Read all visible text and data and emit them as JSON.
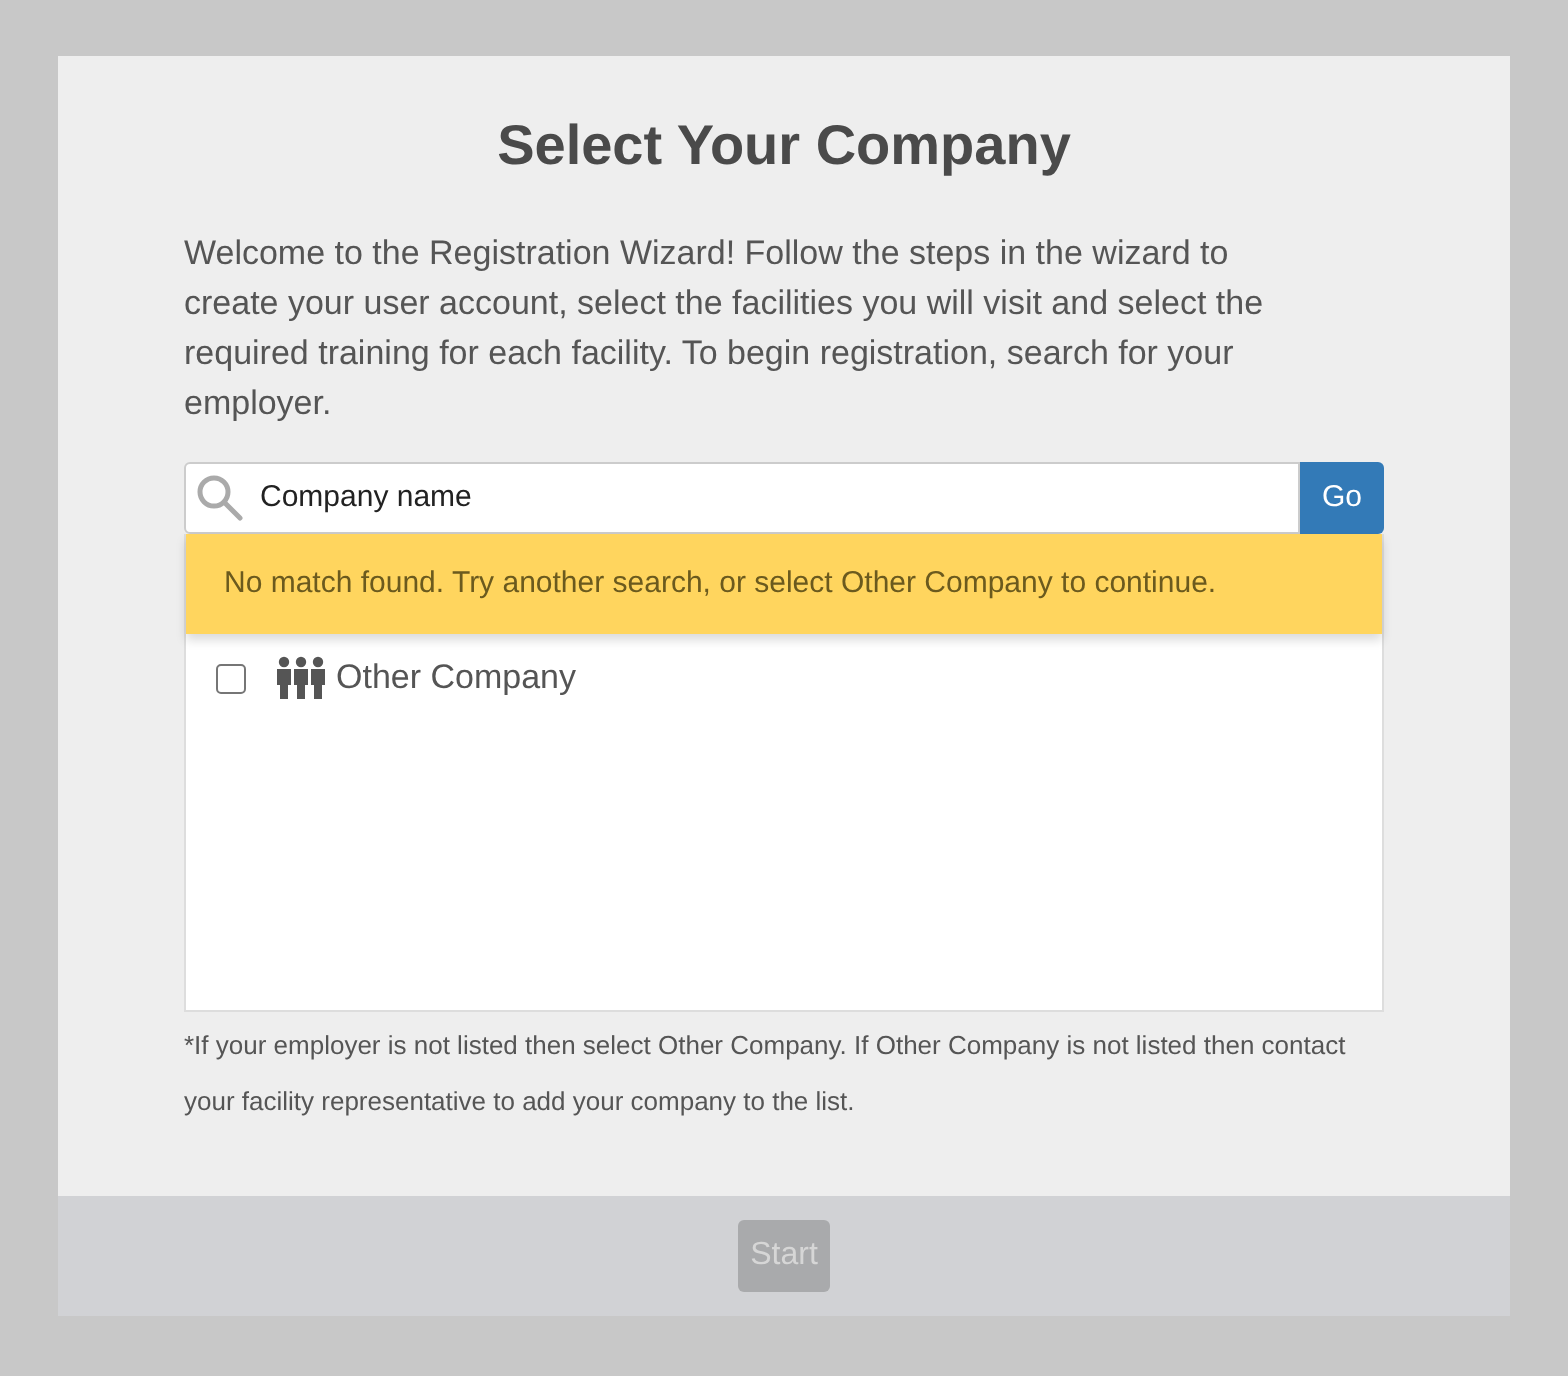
{
  "title": "Select Your Company",
  "intro": "Welcome to the Registration Wizard! Follow the steps in the wizard to create your user account, select the facilities you will visit and select the required training for each facility. To begin registration, search for your employer.",
  "search": {
    "value": "Company name",
    "button": "Go"
  },
  "alert": "No match found. Try another search, or select Other Company to continue.",
  "companies": [
    {
      "name": "Other Company",
      "checked": false
    }
  ],
  "note": "*If your employer is not listed then select Other Company. If Other Company is not listed then contact your facility representative to add your company to the list.",
  "start_button": {
    "label": "Start",
    "disabled": true
  }
}
